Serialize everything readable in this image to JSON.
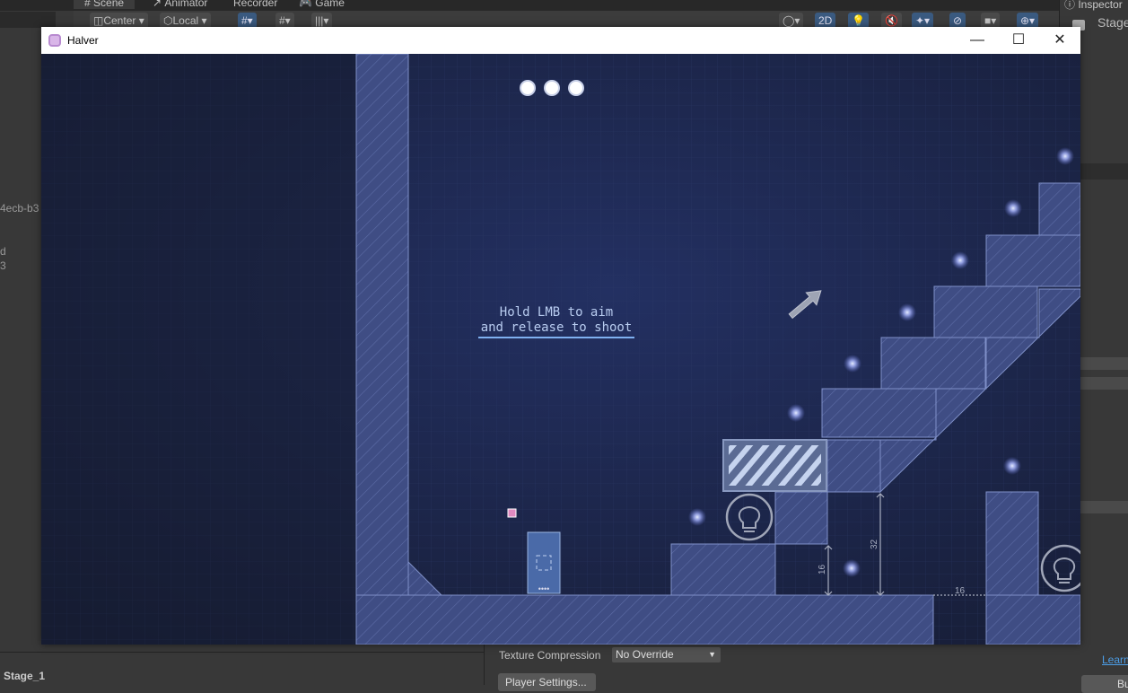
{
  "editor": {
    "tabs": [
      "Scene",
      "Animator",
      "Recorder",
      "Game"
    ],
    "inspector_tab": "Inspector",
    "toolbar": {
      "pivot": "Center",
      "space": "Local",
      "mode_2d": "2D"
    },
    "left_fragments": [
      "4ecb-b3",
      "d",
      "3"
    ],
    "inspector_fragment": "Stage",
    "bottom_left_label": "Stage_1",
    "texture_compression_label": "Texture Compression",
    "texture_compression_value": "No Override",
    "player_settings_button": "Player Settings...",
    "learn_link": "Learn",
    "build_button": "Bu"
  },
  "window": {
    "title": "Halver",
    "minimize": "—",
    "maximize": "☐",
    "close": "✕"
  },
  "game": {
    "tutorial_line1": "Hold LMB to aim",
    "tutorial_line2": "and release to shoot",
    "lives": 3,
    "dimension_16_vertical": "16",
    "dimension_32": "32",
    "dimension_16_horizontal": "16",
    "colors": {
      "bg": "#1b2340",
      "block": "#4a5a96",
      "line": "#7f90c8",
      "text": "#b8ccf0"
    }
  }
}
